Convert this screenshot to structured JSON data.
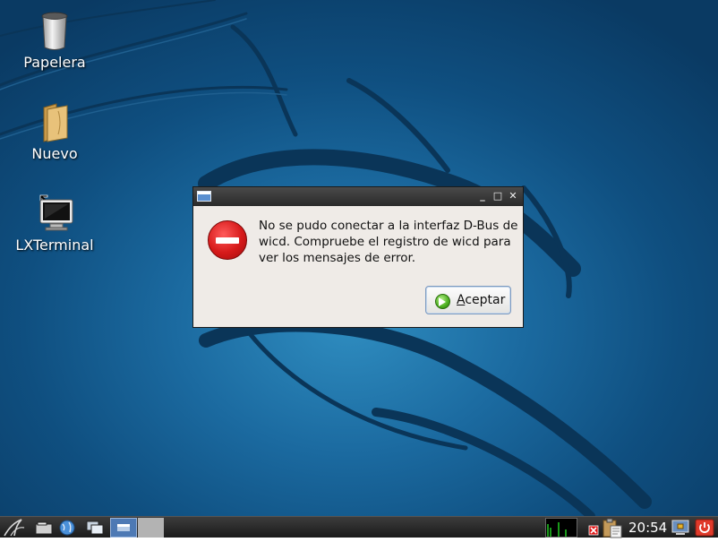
{
  "desktop": {
    "icons": [
      {
        "label": "Papelera",
        "icon": "trash-icon"
      },
      {
        "label": "Nuevo",
        "icon": "folder-icon"
      },
      {
        "label": "LXTerminal",
        "icon": "terminal-icon"
      }
    ]
  },
  "dialog": {
    "title": "",
    "message": "No se pudo conectar a la interfaz D-Bus de wicd. Compruebe el registro de wicd para ver los mensajes de error.",
    "icon": "error-icon",
    "controls": {
      "minimize": "_",
      "maximize": "□",
      "close": "✕"
    },
    "button": {
      "mnemonic": "A",
      "label_rest": "ceptar",
      "icon": "ok-arrow-icon"
    }
  },
  "taskbar": {
    "launchers": [
      "menu-icon",
      "file-manager-icon",
      "browser-icon",
      "show-desktop-icon"
    ],
    "tray": [
      "cpu-monitor",
      "network-error-icon",
      "clipboard-icon",
      "screen-lock-icon",
      "power-icon"
    ],
    "clock": "20:54"
  },
  "colors": {
    "desktop_background": "#1b6aa0",
    "dialog_background": "#efebe7",
    "taskbar_background": "#2a2a2a",
    "active_task": "#4d79b4"
  }
}
